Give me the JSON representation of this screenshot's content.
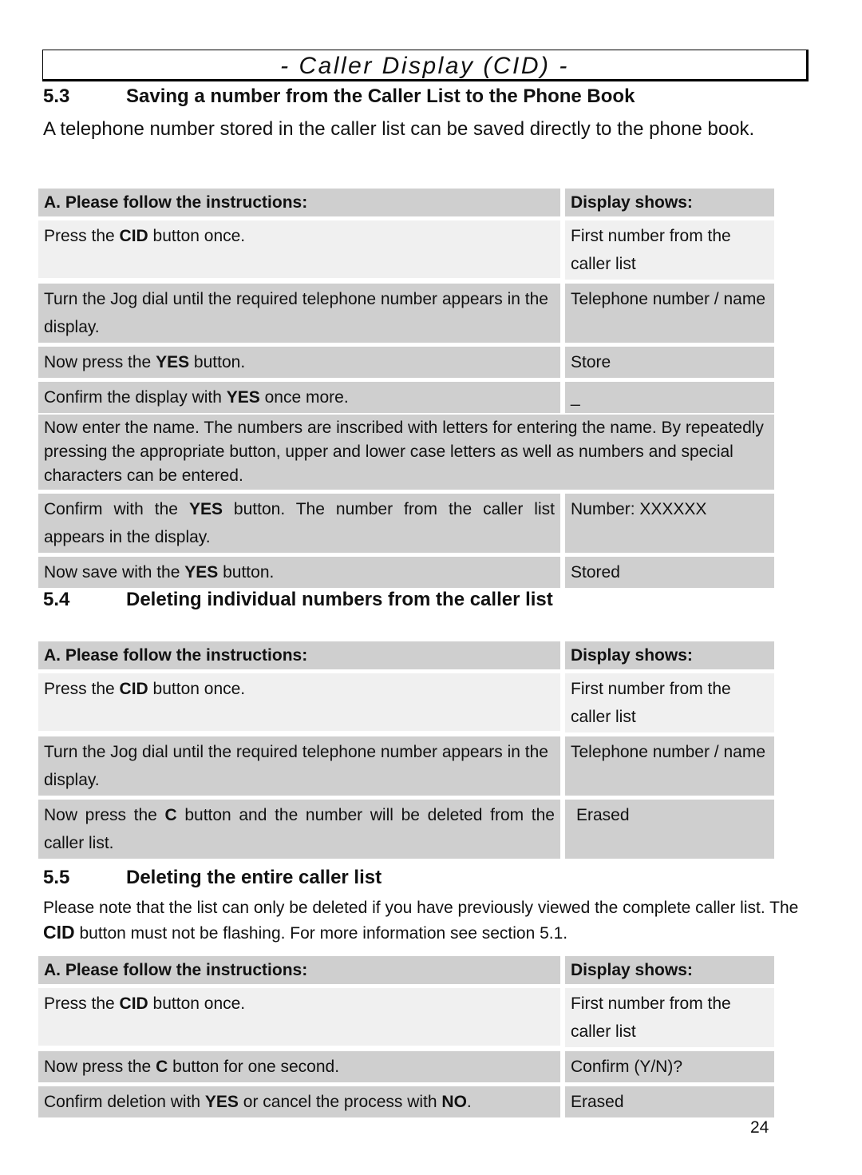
{
  "page_title": "- Caller Display (CID) -",
  "page_number": "24",
  "sections": [
    {
      "number": "5.3",
      "heading": "Saving a number from the Caller List to the Phone Book",
      "intro": "A telephone number stored in the caller list can be saved directly to the phone book.",
      "table": {
        "header": {
          "instructions": "A. Please follow the instructions:",
          "display": "Display shows:"
        },
        "rows": [
          {
            "pre": "Press the ",
            "key": "CID",
            "post": " button once.",
            "display": "First number from the caller list"
          },
          {
            "pre": "Turn the Jog dial until the required telephone number appears in the display.",
            "key": "",
            "post": "",
            "display": "Telephone number / name"
          },
          {
            "pre": "Now press the ",
            "key": "YES",
            "post": " button.",
            "display": "Store"
          },
          {
            "pre": "Confirm the display with ",
            "key": "YES",
            "post": " once more.",
            "display": "_"
          },
          {
            "full": "Now enter the name. The numbers are inscribed with letters for entering the name. By repeatedly pressing the appropriate button, upper and lower case letters as well as numbers and special characters can be entered."
          },
          {
            "pre": "Confirm with the ",
            "key": "YES",
            "post": " button. The number from the caller list appears in the display.",
            "display": "Number: XXXXXX"
          },
          {
            "pre": "Now save with the ",
            "key": "YES",
            "post": " button.",
            "display": "Stored"
          }
        ]
      }
    },
    {
      "number": "5.4",
      "heading": "Deleting individual numbers from the caller list",
      "table": {
        "header": {
          "instructions": "A. Please follow the instructions:",
          "display": "Display shows:"
        },
        "rows": [
          {
            "pre": "Press the ",
            "key": "CID",
            "post": " button once.",
            "display": "First number from the caller list"
          },
          {
            "pre": "Turn the Jog dial until the required telephone number appears in the display.",
            "key": "",
            "post": "",
            "display": "Telephone number / name"
          },
          {
            "pre": "Now press the ",
            "key": "C",
            "post": " button and the number will be deleted from the caller list.",
            "display": "Erased"
          }
        ]
      }
    },
    {
      "number": "5.5",
      "heading": "Deleting the entire caller list",
      "intro_pre": "Please note that the list can only be deleted if you have previously viewed the complete caller list. The ",
      "intro_key": "CID",
      "intro_post": " button must not be flashing. For more information see section 5.1.",
      "table": {
        "header": {
          "instructions": "A. Please follow the instructions:",
          "display": "Display shows:"
        },
        "rows": [
          {
            "pre": "Press the ",
            "key": "CID",
            "post": " button once.",
            "display": "First number from the caller list"
          },
          {
            "pre": "Now press the ",
            "key": "C",
            "post": " button for one second.",
            "display": "Confirm (Y/N)?"
          },
          {
            "pre": "Confirm deletion with ",
            "key": "YES",
            "post": " or cancel the process with ",
            "key2": "NO",
            "post2": ".",
            "display": "Erased"
          }
        ]
      }
    }
  ]
}
